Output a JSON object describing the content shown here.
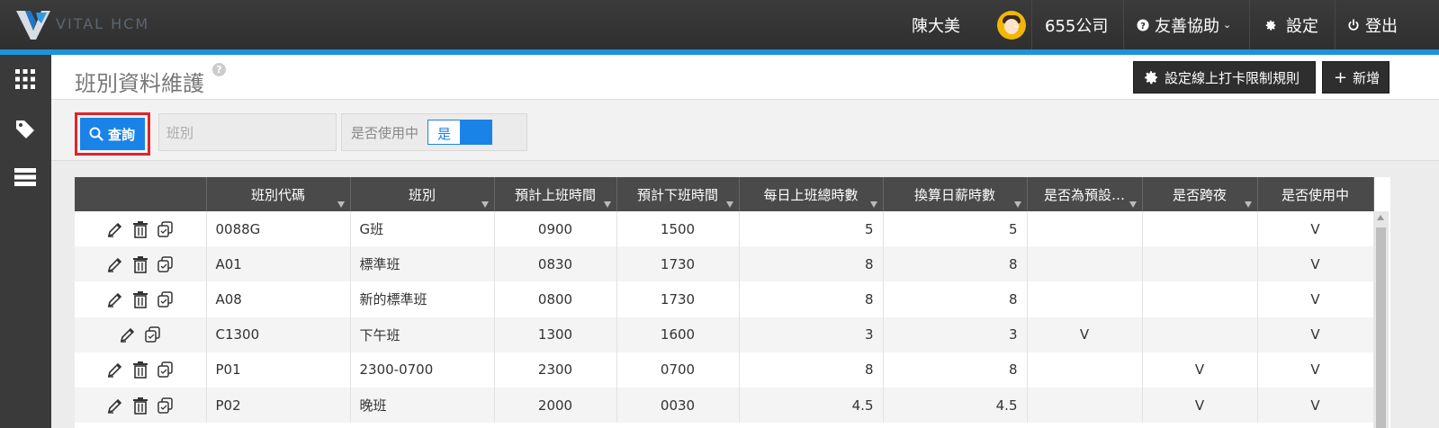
{
  "app": {
    "logo_text": "VITAL HCM"
  },
  "topbar": {
    "user_name": "陳大美",
    "company": "655公司",
    "help_label": "友善協助",
    "settings_label": "設定",
    "logout_label": "登出",
    "accent_color": "#1d94d6"
  },
  "sidebar": {
    "icons": [
      "grid-icon",
      "tag-icon",
      "server-icon"
    ]
  },
  "page": {
    "title": "班別資料維護",
    "rules_button": "設定線上打卡限制規則",
    "add_button": "新增"
  },
  "filter": {
    "search_button": "查詢",
    "shift_placeholder": "班別",
    "active_label": "是否使用中",
    "active_value": "是"
  },
  "table": {
    "columns": [
      "",
      "班別代碼",
      "班別",
      "預計上班時間",
      "預計下班時間",
      "每日上班總時數",
      "換算日薪時數",
      "是否為預設…",
      "是否跨夜",
      "是否使用中"
    ],
    "rows": [
      {
        "code": "0088G",
        "name": "G班",
        "start": "0900",
        "end": "1500",
        "hours": "5",
        "daily": "5",
        "default": "",
        "overnight": "",
        "active": "V",
        "deletable": true
      },
      {
        "code": "A01",
        "name": "標準班",
        "start": "0830",
        "end": "1730",
        "hours": "8",
        "daily": "8",
        "default": "",
        "overnight": "",
        "active": "V",
        "deletable": true
      },
      {
        "code": "A08",
        "name": "新的標準班",
        "start": "0800",
        "end": "1730",
        "hours": "8",
        "daily": "8",
        "default": "",
        "overnight": "",
        "active": "V",
        "deletable": true
      },
      {
        "code": "C1300",
        "name": "下午班",
        "start": "1300",
        "end": "1600",
        "hours": "3",
        "daily": "3",
        "default": "V",
        "overnight": "",
        "active": "V",
        "deletable": false
      },
      {
        "code": "P01",
        "name": "2300-0700",
        "start": "2300",
        "end": "0700",
        "hours": "8",
        "daily": "8",
        "default": "",
        "overnight": "V",
        "active": "V",
        "deletable": true
      },
      {
        "code": "P02",
        "name": "晚班",
        "start": "2000",
        "end": "0030",
        "hours": "4.5",
        "daily": "4.5",
        "default": "",
        "overnight": "V",
        "active": "V",
        "deletable": true
      }
    ]
  }
}
